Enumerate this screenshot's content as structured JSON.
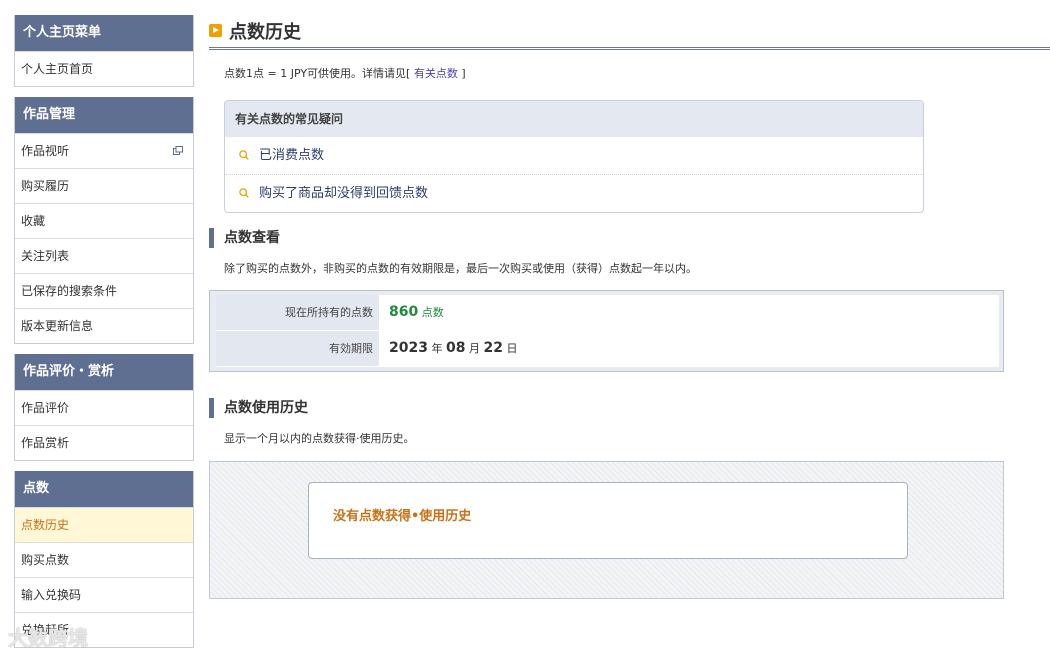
{
  "sidebar": {
    "groups": [
      {
        "title": "个人主页菜单",
        "items": [
          "个人主页首页"
        ]
      },
      {
        "title": "作品管理",
        "items": [
          "作品视听",
          "购买履历",
          "收藏",
          "关注列表",
          "已保存的搜索条件",
          "版本更新信息"
        ]
      },
      {
        "title": "作品评价・赏析",
        "items": [
          "作品评价",
          "作品赏析"
        ]
      },
      {
        "title": "点数",
        "items": [
          "点数历史",
          "购买点数",
          "输入兑换码",
          "兑换赶所"
        ]
      }
    ]
  },
  "page": {
    "title": "点数历史"
  },
  "note": {
    "text": "点数1点 = 1 JPY可供使用。详情请见[",
    "link": "有关点数",
    "suffix": "]"
  },
  "faq": {
    "title": "有关点数的常见疑问",
    "items": [
      "已消费点数",
      "购买了商品却没得到回馈点数"
    ]
  },
  "points_section": {
    "title": "点数查看",
    "desc": "除了购买的点数外，非购买的点数的有效期限是，最后一次购买或使用（获得）点数起一年以内。",
    "current_label": "现在所持有的点数",
    "current_value": "860",
    "current_unit": "点数",
    "expiry_label": "有効期限",
    "expiry_year": "2023",
    "expiry_year_unit": "年",
    "expiry_month": "08",
    "expiry_month_unit": "月",
    "expiry_day": "22",
    "expiry_day_unit": "日"
  },
  "history_section": {
    "title": "点数使用历史",
    "desc": "显示一个月以内的点数获得·使用历史。",
    "empty_message": "没有点数获得•使用历史"
  },
  "watermark": "大数跨境",
  "colors": {
    "sidebar_header": "#5f6f91",
    "active_bg": "#fff7d6",
    "accent_orange": "#c8731a",
    "points_green": "#1e8c3a",
    "title_icon": "#f0a000"
  },
  "icons": {
    "external": "external-window-icon",
    "question": "search-question-icon",
    "title": "play-box-icon"
  }
}
